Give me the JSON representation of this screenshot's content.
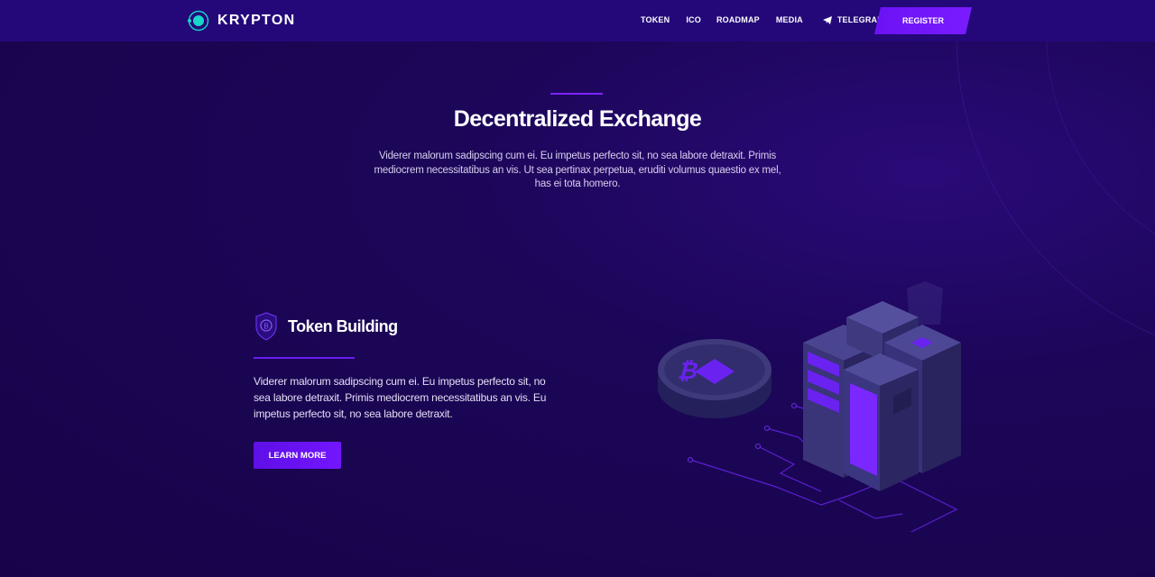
{
  "header": {
    "brand": "KRYPTON",
    "logo_icon": "krypton-logo-icon",
    "nav": [
      {
        "label": "TOKEN"
      },
      {
        "label": "ICO"
      },
      {
        "label": "ROADMAP"
      },
      {
        "label": "MEDIA"
      },
      {
        "label": "TELEGRAM",
        "icon": "telegram-icon"
      }
    ],
    "register_label": "REGISTER"
  },
  "hero": {
    "title": "Decentralized Exchange",
    "text": "Viderer malorum sadipscing cum ei. Eu impetus perfecto sit, no sea labore detraxit. Primis mediocrem necessitatibus an vis. Ut sea pertinax perpetua, eruditi volumus quaestio ex mel, has ei tota homero."
  },
  "feature": {
    "icon": "shield-coin-icon",
    "title": "Token Building",
    "text": "Viderer malorum sadipscing cum ei. Eu impetus perfecto sit, no sea labore detraxit. Primis mediocrem necessitatibus an vis. Eu impetus perfecto sit, no sea labore detraxit.",
    "button_label": "LEARN MORE",
    "illustration": "crypto-server-illustration"
  },
  "colors": {
    "background": "#1c0659",
    "header": "#24087a",
    "accent": "#7316ff",
    "logo_cyan": "#18d6c8"
  }
}
